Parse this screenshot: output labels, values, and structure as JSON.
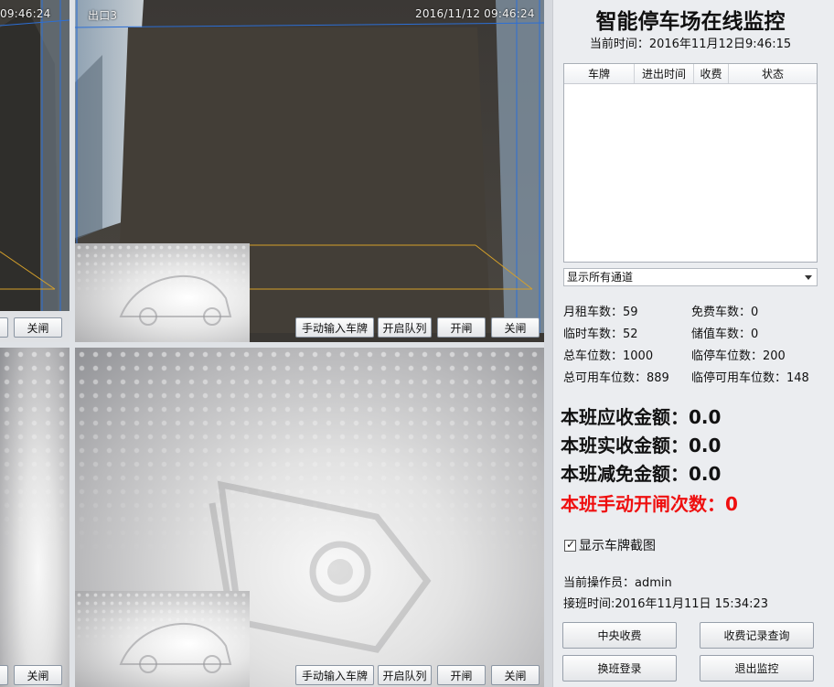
{
  "colors": {
    "accent_red": "#ef0f0f",
    "panel_bg": "#ebedf0",
    "camera_bg": "#45423d"
  },
  "cameras": {
    "cam1": {
      "timestamp": "09:46:24",
      "buttons": {
        "close": "关闸"
      }
    },
    "cam2": {
      "name": "出口3",
      "timestamp": "2016/11/12  09:46:24",
      "buttons": {
        "manual_plate": "手动输入车牌",
        "open_queue": "开启队列",
        "open_gate": "开闸",
        "close_gate": "关闸"
      }
    },
    "cam3": {
      "buttons": {
        "close": "关闸"
      }
    },
    "cam4": {
      "buttons": {
        "manual_plate": "手动输入车牌",
        "open_queue": "开启队列",
        "open_gate": "开闸",
        "close_gate": "关闸"
      }
    }
  },
  "panel": {
    "title": "智能停车场在线监控",
    "current_time": "当前时间：2016年11月12日9:46:15",
    "table": {
      "headers": [
        "车牌",
        "进出时间",
        "收费",
        "状态"
      ],
      "rows": []
    },
    "channel_select": "显示所有通道",
    "stats": {
      "monthly": "月租车数：59",
      "free": "免费车数：0",
      "temp": "临时车数：52",
      "stored": "储值车数：0",
      "total_spaces": "总车位数：1000",
      "temp_spaces": "临停车位数：200",
      "total_available": "总可用车位数：889",
      "temp_available": "临停可用车位数：148"
    },
    "shift": {
      "due": "本班应收金额：0.0",
      "received": "本班实收金额：0.0",
      "waived": "本班减免金额：0.0",
      "manual_open": "本班手动开闸次数：0"
    },
    "show_plate_checkbox": {
      "label": "显示车牌截图",
      "checked": true
    },
    "operator": "当前操作员：admin",
    "shift_start": "接班时间:2016年11月11日 15:34:23",
    "buttons": {
      "central_charge": "中央收费",
      "fee_records": "收费记录查询",
      "shift_login": "换班登录",
      "exit_monitor": "退出监控"
    }
  }
}
